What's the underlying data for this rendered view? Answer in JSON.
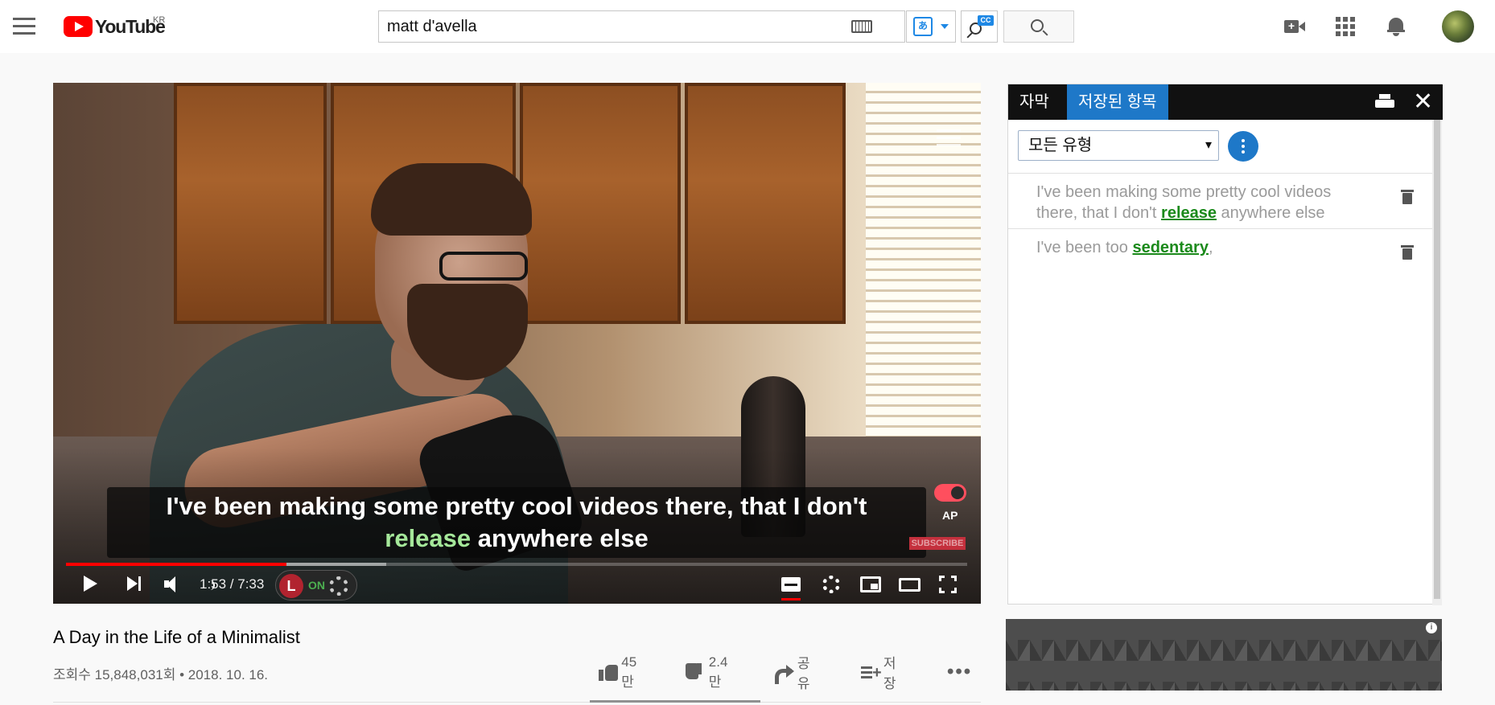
{
  "masthead": {
    "logo_text": "YouTube",
    "logo_region": "KR",
    "search_value": "matt d'avella",
    "cc_badge": "CC",
    "translate_glyph": "あ"
  },
  "player": {
    "caption_line1": "I've been making some pretty cool videos there, that I don't",
    "caption_highlight": "release",
    "caption_line2_rest": " anywhere else",
    "ap_label": "AP",
    "watermark": "SUBSCRIBE",
    "time_display": "1:53 / 7:33",
    "ext_on_label": "ON",
    "ext_logo": "L",
    "played_fraction": 0.245,
    "loaded_fraction": 0.355
  },
  "video": {
    "title": "A Day in the Life of a Minimalist",
    "meta": "조회수 15,848,031회 • 2018. 10. 16.",
    "likes": "45만",
    "dislikes": "2.4만",
    "share_label": "공유",
    "save_label": "저장",
    "more_label": "•••"
  },
  "panel": {
    "tab_subtitles": "자막",
    "tab_saved": "저장된 항목",
    "filter_value": "모든 유형",
    "items": [
      {
        "before": "I've been making some pretty cool videos there, that I don't ",
        "word": "release",
        "after": " anywhere else"
      },
      {
        "before": "I've been too ",
        "word": "sedentary",
        "after": ","
      }
    ]
  },
  "ad": {
    "info": "i"
  },
  "colors": {
    "brand_red": "#ff0000",
    "accent_blue": "#1e78c8",
    "highlight_green": "#1b8a1b",
    "caption_highlight": "#a5e89a"
  }
}
